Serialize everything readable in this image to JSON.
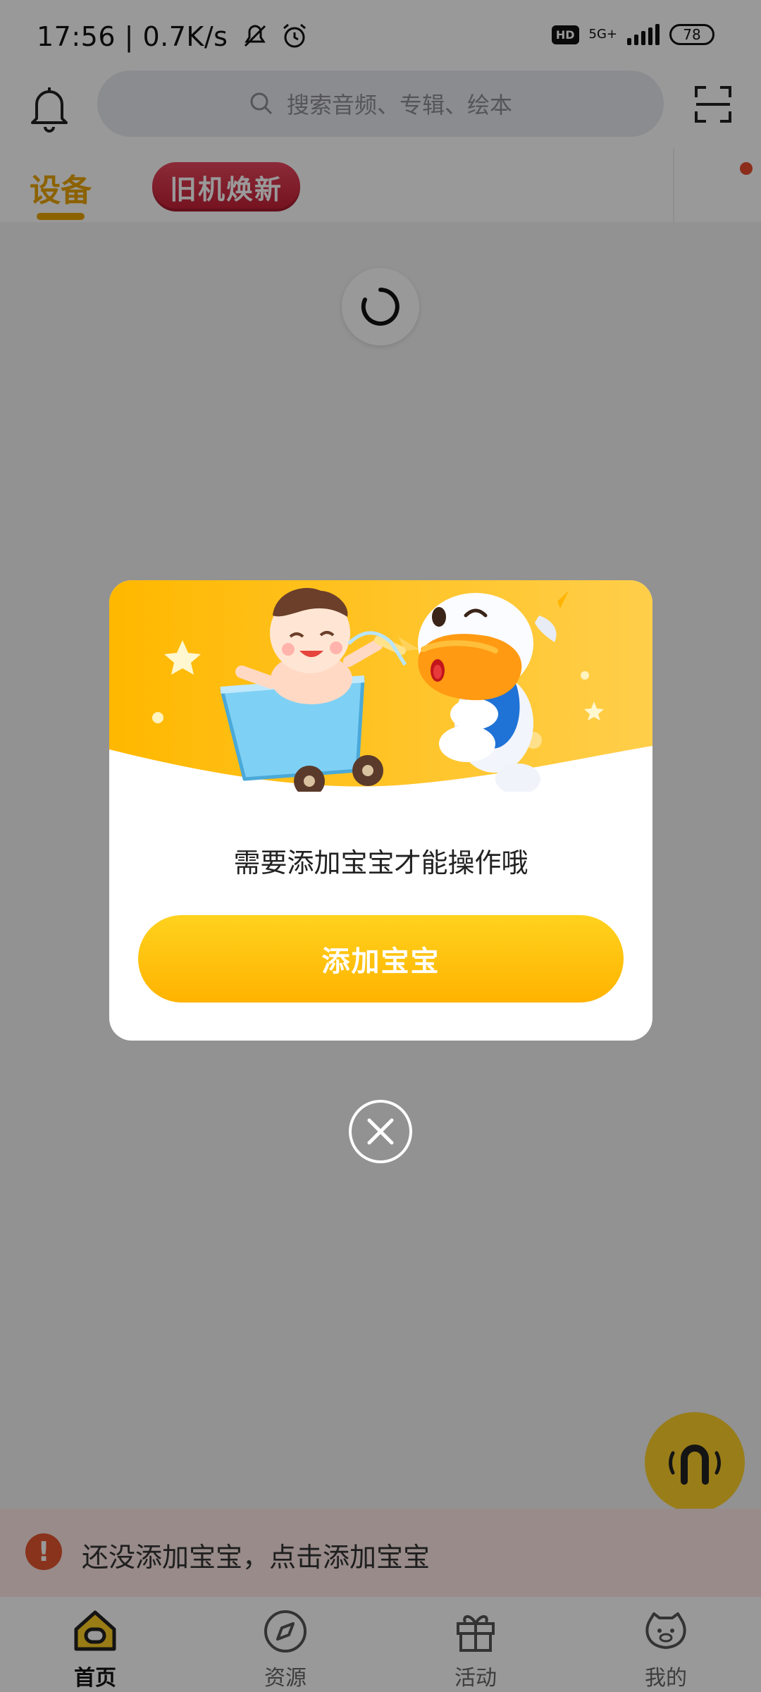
{
  "status_bar": {
    "time": "17:56",
    "speed": "0.7K/s",
    "hd": "HD",
    "network": "5G+",
    "battery": "78"
  },
  "header": {
    "search_placeholder": "搜索音频、专辑、绘本",
    "icons": [
      "bell-icon",
      "search-icon",
      "scan-icon"
    ]
  },
  "tabs": {
    "device": "设备",
    "promo": "旧机焕新"
  },
  "modal": {
    "message": "需要添加宝宝才能操作哦",
    "button": "添加宝宝"
  },
  "notice": {
    "icon": "!",
    "text": "还没添加宝宝，点击添加宝宝"
  },
  "tabbar": {
    "items": [
      {
        "label": "首页",
        "icon": "home-icon",
        "active": true
      },
      {
        "label": "资源",
        "icon": "compass-icon",
        "active": false
      },
      {
        "label": "活动",
        "icon": "gift-icon",
        "active": false
      },
      {
        "label": "我的",
        "icon": "profile-icon",
        "active": false
      }
    ]
  },
  "colors": {
    "accent": "#e9a300",
    "button_yellow": "#ffc107",
    "promo_red": "#d4283f",
    "notice_red": "#e5562f"
  }
}
